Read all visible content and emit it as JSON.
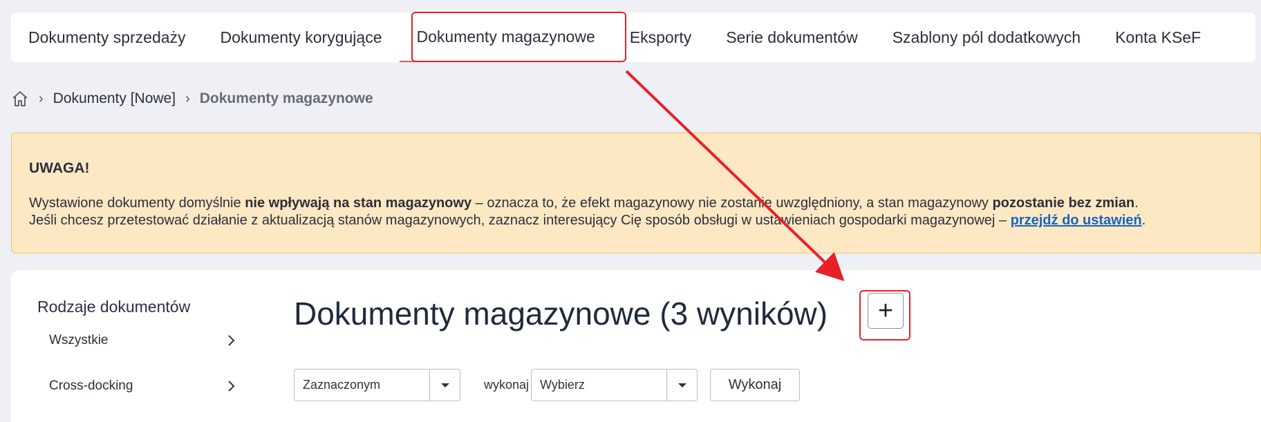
{
  "tabs": [
    {
      "label": "Dokumenty sprzedaży",
      "active": false
    },
    {
      "label": "Dokumenty korygujące",
      "active": false
    },
    {
      "label": "Dokumenty magazynowe",
      "active": true
    },
    {
      "label": "Eksporty",
      "active": false
    },
    {
      "label": "Serie dokumentów",
      "active": false
    },
    {
      "label": "Szablony pól dodatkowych",
      "active": false
    },
    {
      "label": "Konta KSeF",
      "active": false
    }
  ],
  "breadcrumb": {
    "home_icon": "home-icon",
    "items": [
      "Dokumenty [Nowe]",
      "Dokumenty magazynowe"
    ]
  },
  "warning": {
    "title": "UWAGA!",
    "line1_a": "Wystawione dokumenty domyślnie ",
    "line1_b": "nie wpływają na stan magazynowy",
    "line1_c": " – oznacza to, że efekt magazynowy nie zostanie uwzględniony, a stan magazynowy ",
    "line1_d": "pozostanie bez zmian",
    "line1_e": ".",
    "line2_a": "Jeśli chcesz przetestować działanie z aktualizacją stanów magazynowych, zaznacz interesujący Cię sposób obsługi w ustawieniach gospodarki magazynowej – ",
    "line2_link": "przejdź do ustawień",
    "line2_end": "."
  },
  "sidebar": {
    "title": "Rodzaje dokumentów",
    "items": [
      {
        "label": "Wszystkie"
      },
      {
        "label": "Cross-docking"
      }
    ]
  },
  "main": {
    "title": "Dokumenty magazynowe (3 wyników)",
    "add_icon": "+",
    "selection_select": "Zaznaczonym",
    "execute_label": "wykonaj",
    "action_select": "Wybierz",
    "execute_button": "Wykonaj"
  },
  "colors": {
    "annotation": "#e8202a",
    "warning_bg": "#fde8c4",
    "link": "#1565c0"
  }
}
